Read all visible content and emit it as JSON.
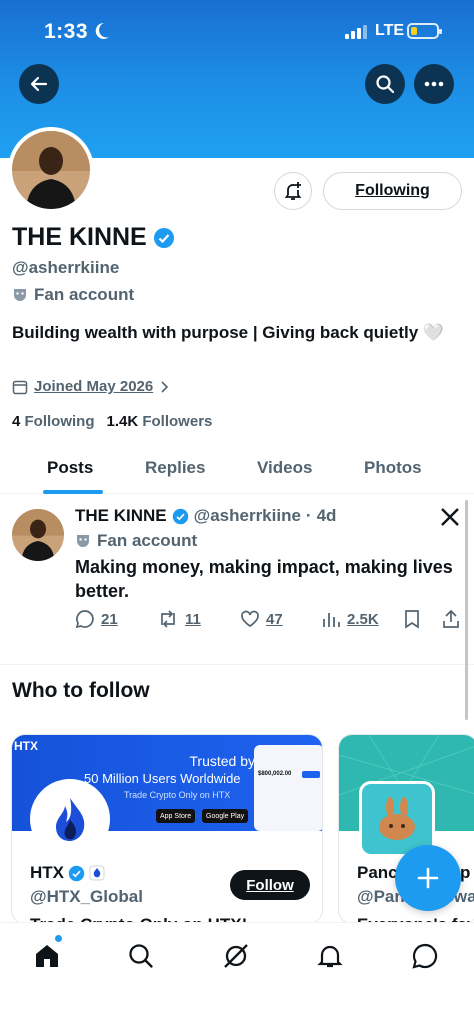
{
  "status_bar": {
    "time": "1:33",
    "network": "LTE"
  },
  "profile": {
    "display_name": "THE KINNE",
    "handle": "@asherrkiine",
    "label": "Fan account",
    "bio": "Building wealth with purpose | Giving back quietly 🤍",
    "joined": "Joined May 2026",
    "following_count": "4",
    "following_label": "Following",
    "followers_count": "1.4K",
    "followers_label": "Followers",
    "follow_button": "Following"
  },
  "tabs": [
    "Posts",
    "Replies",
    "Videos",
    "Photos"
  ],
  "post": {
    "name": "THE KINNE",
    "handle": "@asherrkiine",
    "dot": "·",
    "age": "4d",
    "label": "Fan account",
    "text": "Making money, making impact, making lives better.",
    "replies": "21",
    "reposts": "11",
    "likes": "47",
    "views": "2.5K"
  },
  "who_to_follow": {
    "title": "Who to follow",
    "cards": [
      {
        "name": "HTX",
        "handle": "@HTX_Global",
        "follow": "Follow",
        "cut_text": "Trade Crypto Only on HTX!",
        "banner": {
          "brand": "HTX",
          "trusted": "Trusted by",
          "users": "50 Million Users Worldwide",
          "trade": "Trade Crypto Only on HTX",
          "app_store": "App Store",
          "google_play": "Google Play",
          "amount": "$800,002.00"
        }
      },
      {
        "name": "PancakeSwap",
        "handle": "@PancakeSwap",
        "cut_text": "Everyone's fav"
      }
    ]
  },
  "colors": {
    "accent": "#1d9bf0",
    "banner": "#1d8fe6",
    "text": "#0f1419",
    "muted": "#536471"
  }
}
